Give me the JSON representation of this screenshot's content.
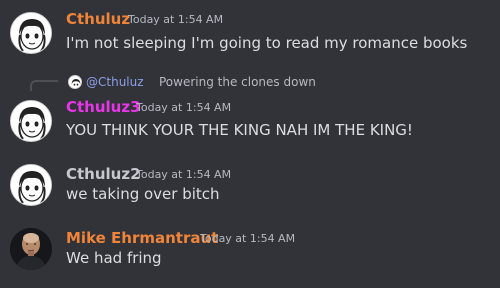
{
  "messages": [
    {
      "author": "Cthuluz",
      "timestamp": "Today at 1:54 AM",
      "content": "I'm not sleeping I'm going to read my romance books",
      "author_color": "#f0853a",
      "avatar_icon": "cartoon-face-avatar"
    },
    {
      "reply": {
        "mention": "@Cthuluz",
        "text": "Powering the clones down"
      },
      "author": "Cthuluz3",
      "timestamp": "Today at 1:54 AM",
      "content": "YOU THINK YOUR THE KING NAH IM THE KING!",
      "author_color": "#e835e8",
      "avatar_icon": "cartoon-face-avatar"
    },
    {
      "author": "Cthuluz2",
      "timestamp": "Today at 1:54 AM",
      "content": "we taking over bitch",
      "author_color": "#c6cad0",
      "avatar_icon": "cartoon-face-avatar"
    },
    {
      "author": "Mike Ehrmantraut",
      "timestamp": "Today at 1:54 AM",
      "content": "We had fring",
      "author_color": "#f0853a",
      "avatar_icon": "photo-avatar"
    }
  ]
}
